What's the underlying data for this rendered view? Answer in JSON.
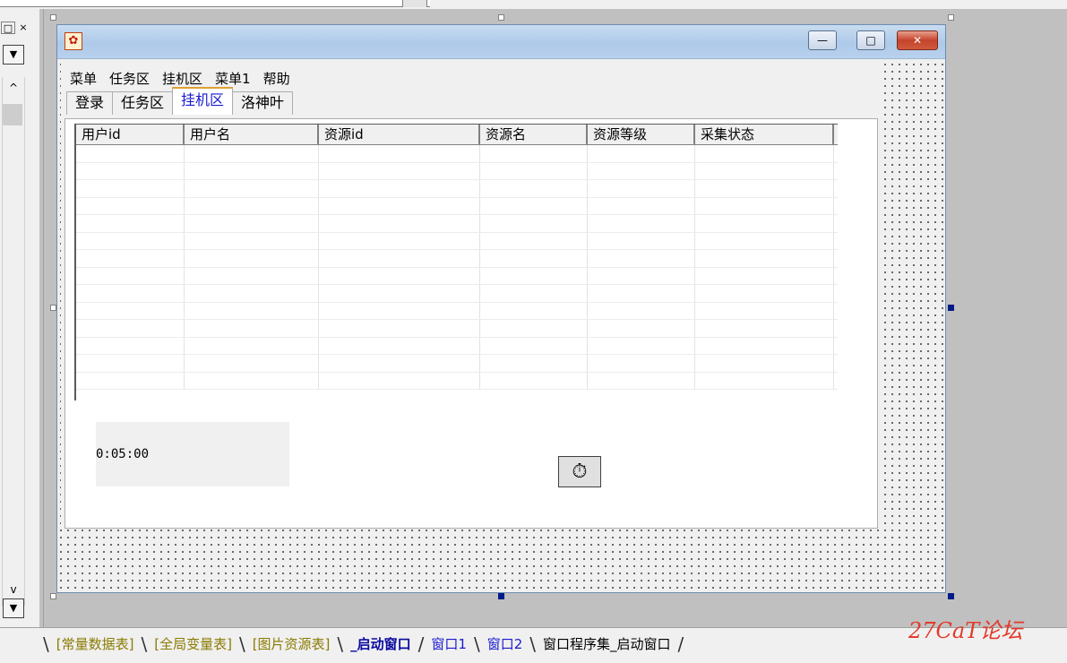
{
  "top": {
    "combo_text": ""
  },
  "left_panel": {
    "pin_symbol": "□",
    "close_symbol": "×",
    "dropdown_symbol": "▼",
    "scroll_up_symbol": "^",
    "scroll_down_symbol": "v"
  },
  "form": {
    "title": "",
    "caption_buttons": {
      "minimize": "—",
      "maximize": "□",
      "close": "✕"
    },
    "menu": [
      "菜单",
      "任务区",
      "挂机区",
      "菜单1",
      "帮助"
    ],
    "tabs": [
      {
        "label": "登录",
        "active": false
      },
      {
        "label": "任务区",
        "active": false
      },
      {
        "label": "挂机区",
        "active": true
      },
      {
        "label": "洛神叶",
        "active": false
      }
    ],
    "grid": {
      "columns": [
        "用户id",
        "用户名",
        "资源id",
        "资源名",
        "资源等级",
        "采集状态"
      ],
      "row_count": 14
    },
    "time_label": "0:05:00",
    "timer_icon": "timer-stopwatch"
  },
  "bottom_tabs": [
    {
      "label": "[常量数据表]",
      "kind": "tbl"
    },
    {
      "label": "[全局变量表]",
      "kind": "tbl"
    },
    {
      "label": "[图片资源表]",
      "kind": "tbl"
    },
    {
      "label": "_启动窗口",
      "kind": "cur"
    },
    {
      "label": "窗口1",
      "kind": "win"
    },
    {
      "label": "窗口2",
      "kind": "win"
    },
    {
      "label": "窗口程序集_启动窗口",
      "kind": "plain"
    }
  ],
  "watermark": "27CaT论坛",
  "colors": {
    "selection_handle": "#001b86",
    "active_tab_text": "#1a1ad0",
    "watermark": "#e23a2a"
  }
}
